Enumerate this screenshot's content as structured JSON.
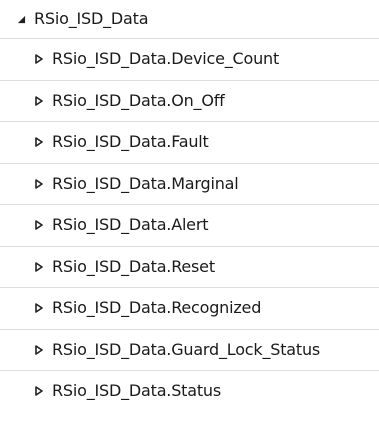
{
  "tree": {
    "root": {
      "label": "RSio_ISD_Data",
      "expanded": true,
      "icon": "triangle-down-icon"
    },
    "children": [
      {
        "label": "RSio_ISD_Data.Device_Count",
        "icon": "triangle-right-icon"
      },
      {
        "label": "RSio_ISD_Data.On_Off",
        "icon": "triangle-right-icon"
      },
      {
        "label": "RSio_ISD_Data.Fault",
        "icon": "triangle-right-icon"
      },
      {
        "label": "RSio_ISD_Data.Marginal",
        "icon": "triangle-right-icon"
      },
      {
        "label": "RSio_ISD_Data.Alert",
        "icon": "triangle-right-icon"
      },
      {
        "label": "RSio_ISD_Data.Reset",
        "icon": "triangle-right-icon"
      },
      {
        "label": "RSio_ISD_Data.Recognized",
        "icon": "triangle-right-icon"
      },
      {
        "label": "RSio_ISD_Data.Guard_Lock_Status",
        "icon": "triangle-right-icon"
      },
      {
        "label": "RSio_ISD_Data.Status",
        "icon": "triangle-right-icon"
      }
    ],
    "colors": {
      "text": "#1a1a1a",
      "divider": "#dedede",
      "glyph": "#222222",
      "background": "#ffffff"
    }
  }
}
